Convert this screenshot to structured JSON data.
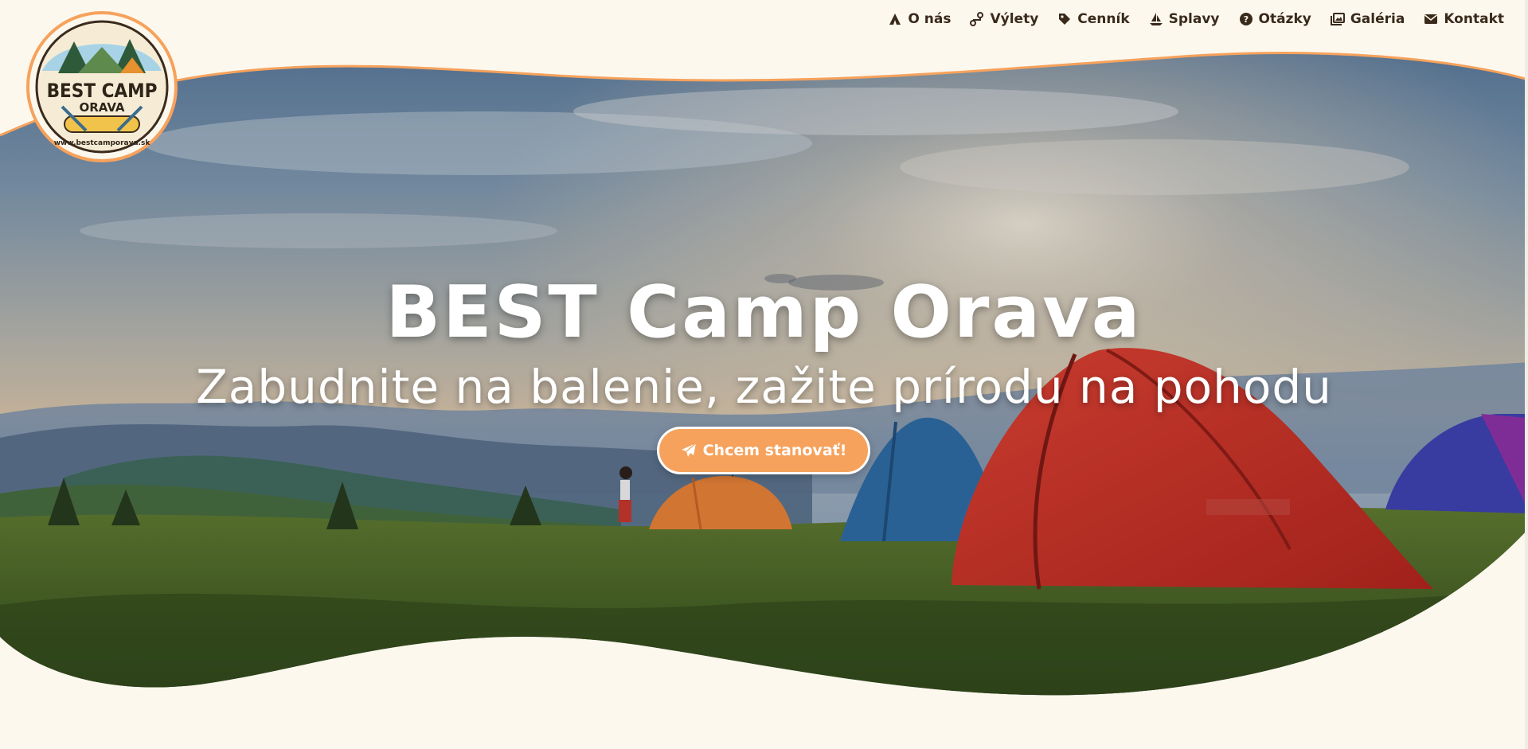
{
  "site": {
    "logo": {
      "line1": "BEST CAMP",
      "line2": "ORAVA",
      "url": "www.bestcamporava.sk"
    }
  },
  "nav": {
    "items": [
      {
        "label": "O nás",
        "icon": "tent-icon"
      },
      {
        "label": "Výlety",
        "icon": "route-icon"
      },
      {
        "label": "Cenník",
        "icon": "tag-icon"
      },
      {
        "label": "Splavy",
        "icon": "sailboat-icon"
      },
      {
        "label": "Otázky",
        "icon": "question-circle-icon"
      },
      {
        "label": "Galéria",
        "icon": "images-icon"
      },
      {
        "label": "Kontakt",
        "icon": "envelope-icon"
      }
    ]
  },
  "hero": {
    "title": "BEST Camp Orava",
    "subtitle": "Zabudnite na balenie, zažite prírodu na pohodu",
    "cta_label": "Chcem stanovať!",
    "cta_icon": "paper-plane-icon"
  },
  "colors": {
    "accent": "#f6a25c",
    "background": "#fdf8ee",
    "nav_text": "#3a2a1c",
    "logo_green": "#2f5a3a"
  }
}
